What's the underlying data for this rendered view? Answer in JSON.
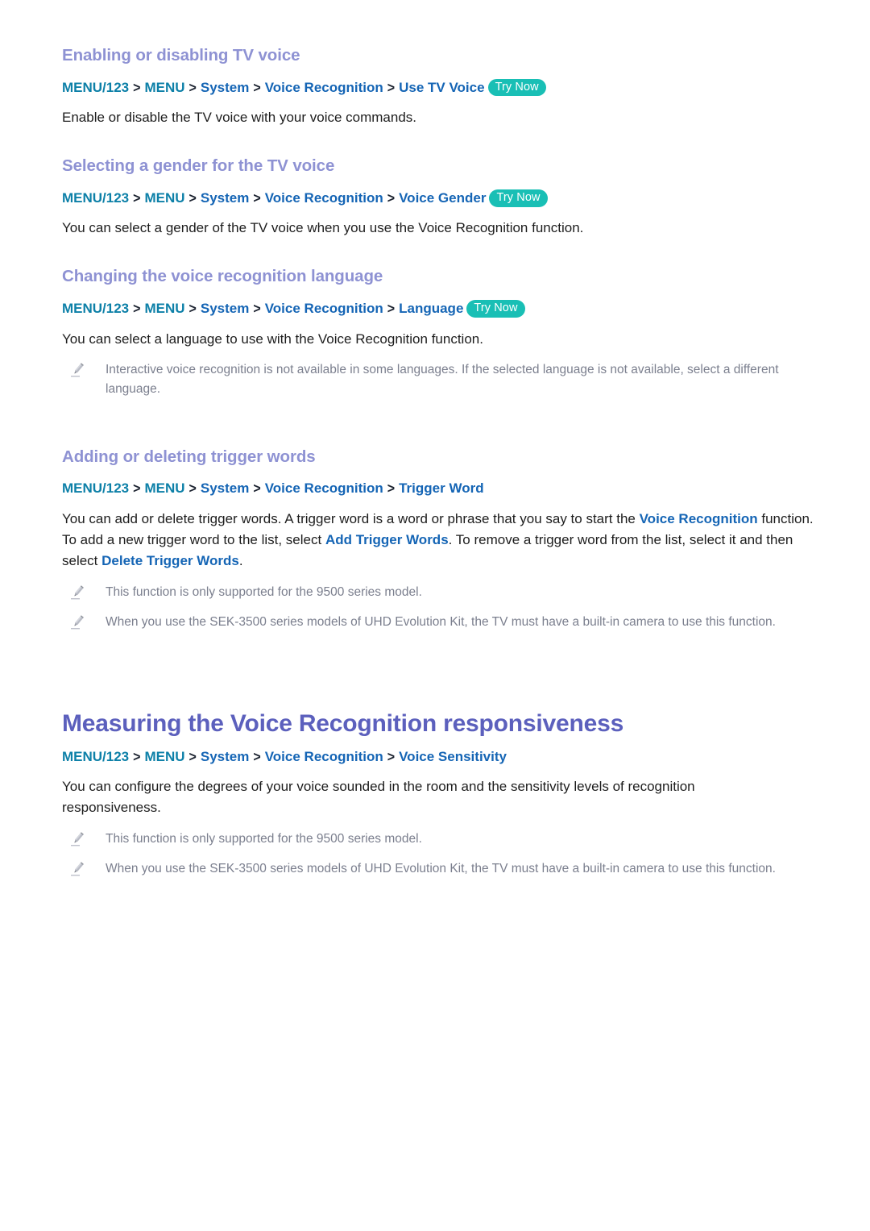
{
  "colors": {
    "h1": "#5c60bd",
    "h2": "#8e92d3",
    "path_menu": "#0d80a8",
    "path_seg": "#1565b5",
    "chevron": "#1c2330",
    "try_now_bg": "#19bfb5",
    "body": "#1d1d1d",
    "note": "#7b7f8e",
    "inline_highlight": "#1565b5"
  },
  "labels": {
    "chevron": ">",
    "try_now": "Try Now",
    "pencil_icon": "pencil-icon"
  },
  "sections": {
    "enable_tv_voice": {
      "heading": "Enabling or disabling TV voice",
      "path": {
        "menu123": "MENU/123",
        "menu": "MENU",
        "system": "System",
        "voice_recognition": "Voice Recognition",
        "leaf": "Use TV Voice",
        "try_now": "Try Now"
      },
      "body": "Enable or disable the TV voice with your voice commands."
    },
    "select_gender": {
      "heading": "Selecting a gender for the TV voice",
      "path": {
        "menu123": "MENU/123",
        "menu": "MENU",
        "system": "System",
        "voice_recognition": "Voice Recognition",
        "leaf": "Voice Gender",
        "try_now": "Try Now"
      },
      "body": "You can select a gender of the TV voice when you use the Voice Recognition function."
    },
    "change_language": {
      "heading": "Changing the voice recognition language",
      "path": {
        "menu123": "MENU/123",
        "menu": "MENU",
        "system": "System",
        "voice_recognition": "Voice Recognition",
        "leaf": "Language",
        "try_now": "Try Now"
      },
      "body": "You can select a language to use with the Voice Recognition function.",
      "notes": [
        "Interactive voice recognition is not available in some languages. If the selected language is not available, select a different language."
      ]
    },
    "trigger_words": {
      "heading": "Adding or deleting trigger words",
      "path": {
        "menu123": "MENU/123",
        "menu": "MENU",
        "system": "System",
        "voice_recognition": "Voice Recognition",
        "leaf": "Trigger Word"
      },
      "body_parts": {
        "p1": "You can add or delete trigger words. A trigger word is a word or phrase that you say to start the ",
        "hl1": "Voice Recognition",
        "p2": " function. To add a new trigger word to the list, select ",
        "hl2": "Add Trigger Words",
        "p3": ". To remove a trigger word from the list, select it and then select ",
        "hl3": "Delete Trigger Words",
        "p4": "."
      },
      "notes": [
        "This function is only supported for the 9500 series model.",
        "When you use the SEK-3500 series models of UHD Evolution Kit, the TV must have a built-in camera to use this function."
      ]
    },
    "measuring_responsiveness": {
      "heading": "Measuring the Voice Recognition responsiveness",
      "path": {
        "menu123": "MENU/123",
        "menu": "MENU",
        "system": "System",
        "voice_recognition": "Voice Recognition",
        "leaf": "Voice Sensitivity"
      },
      "body": "You can configure the degrees of your voice sounded in the room and the sensitivity levels of recognition responsiveness.",
      "notes": [
        "This function is only supported for the 9500 series model.",
        "When you use the SEK-3500 series models of UHD Evolution Kit, the TV must have a built-in camera to use this function."
      ]
    }
  }
}
